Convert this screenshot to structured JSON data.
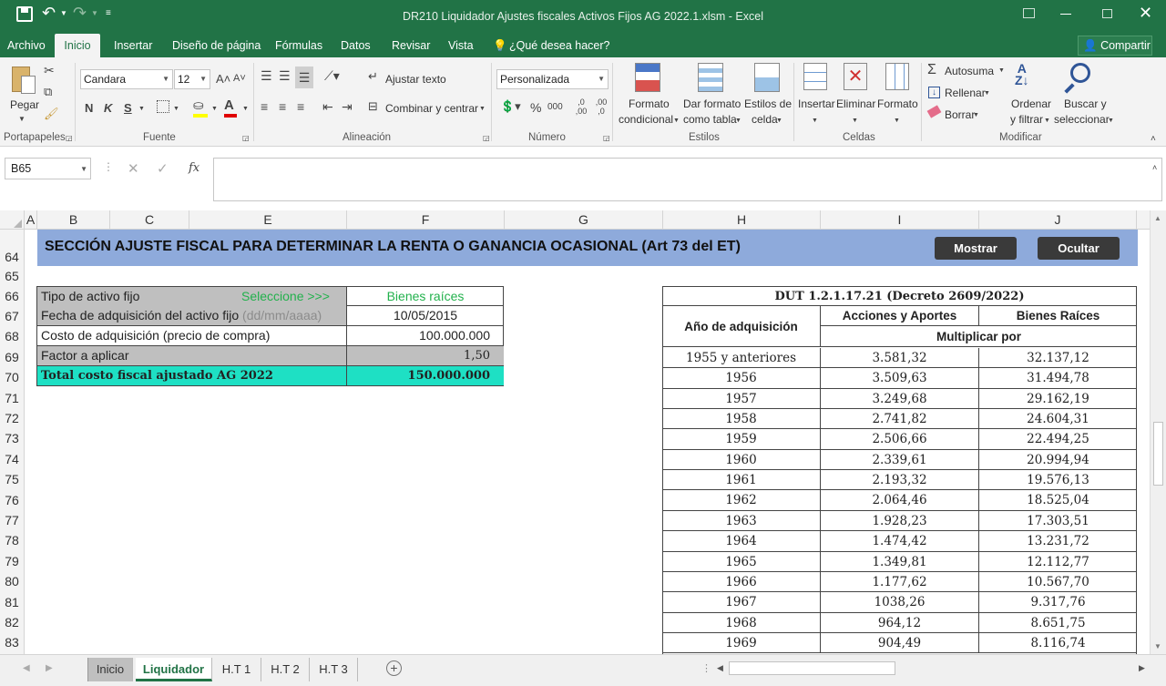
{
  "title": "DR210 Liquidador Ajustes fiscales Activos Fijos AG 2022.1.xlsm - Excel",
  "tabs": [
    "Archivo",
    "Inicio",
    "Insertar",
    "Diseño de página",
    "Fórmulas",
    "Datos",
    "Revisar",
    "Vista",
    "¿Qué desea hacer?"
  ],
  "share_label": "Compartir",
  "ribbon": {
    "paste": "Pegar",
    "font_name": "Candara",
    "font_size": "12",
    "bold": "N",
    "italic": "K",
    "underline": "S",
    "wrap_text": "Ajustar texto",
    "merge_center": "Combinar y centrar",
    "number_format": "Personalizada",
    "percent": "%",
    "thousands": "000",
    "dec_inc": ",0 ,00",
    "dec_dec": ",00 ,0",
    "cond_format": [
      "Formato",
      "condicional"
    ],
    "format_table": [
      "Dar formato",
      "como tabla"
    ],
    "cell_styles": [
      "Estilos de",
      "celda"
    ],
    "insert": "Insertar",
    "delete": "Eliminar",
    "format": "Formato",
    "autosum": "Autosuma",
    "fill": "Rellenar",
    "clear": "Borrar",
    "sort_filter": [
      "Ordenar",
      "y filtrar"
    ],
    "find_select": [
      "Buscar y",
      "seleccionar"
    ],
    "groups": [
      "Portapapeles",
      "Fuente",
      "Alineación",
      "Número",
      "Estilos",
      "Celdas",
      "Modificar"
    ]
  },
  "name_box": "B65",
  "formula": "",
  "columns": [
    "A",
    "B",
    "C",
    "E",
    "F",
    "G",
    "H",
    "I",
    "J"
  ],
  "rows": [
    "64",
    "65",
    "66",
    "67",
    "68",
    "69",
    "70",
    "71",
    "72",
    "73",
    "74",
    "75",
    "76",
    "77",
    "78",
    "79",
    "80",
    "81",
    "82",
    "83"
  ],
  "banner": {
    "title": "SECCIÓN AJUSTE FISCAL PARA DETERMINAR LA RENTA O GANANCIA OCASIONAL (Art 73 del ET)",
    "show": "Mostrar",
    "hide": "Ocultar"
  },
  "left_table": [
    {
      "label": "Tipo de activo fijo",
      "hint": "Seleccione >>>",
      "value": "Bienes raíces"
    },
    {
      "label": "Fecha de adquisición del activo fijo",
      "hint": "(dd/mm/aaaa)",
      "value": "10/05/2015"
    },
    {
      "label": "Costo de adquisición (precio de compra)",
      "value": "100.000.000"
    },
    {
      "label": "Factor a aplicar",
      "value": "1,50"
    },
    {
      "label": "Total costo fiscal ajustado AG 2022",
      "value": "150.000.000"
    }
  ],
  "right_table": {
    "title": "DUT 1.2.1.17.21 (Decreto 2609/2022)",
    "col_year": "Año de adquisición",
    "col_a": "Acciones y Aportes",
    "col_b": "Bienes Raíces",
    "subheader": "Multiplicar por",
    "rows": [
      [
        "1955 y anteriores",
        "3.581,32",
        "32.137,12"
      ],
      [
        "1956",
        "3.509,63",
        "31.494,78"
      ],
      [
        "1957",
        "3.249,68",
        "29.162,19"
      ],
      [
        "1958",
        "2.741,82",
        "24.604,31"
      ],
      [
        "1959",
        "2.506,66",
        "22.494,25"
      ],
      [
        "1960",
        "2.339,61",
        "20.994,94"
      ],
      [
        "1961",
        "2.193,32",
        "19.576,13"
      ],
      [
        "1962",
        "2.064,46",
        "18.525,04"
      ],
      [
        "1963",
        "1.928,23",
        "17.303,51"
      ],
      [
        "1964",
        "1.474,42",
        "13.231,72"
      ],
      [
        "1965",
        "1.349,81",
        "12.112,77"
      ],
      [
        "1966",
        "1.177,62",
        "10.567,70"
      ],
      [
        "1967",
        "1038,26",
        "9.317,76"
      ],
      [
        "1968",
        "964,12",
        "8.651,75"
      ],
      [
        "1969",
        "904,49",
        "8.116,74"
      ]
    ]
  },
  "sheets": [
    "Inicio",
    "Liquidador",
    "H.T 1",
    "H.T 2",
    "H.T 3"
  ],
  "colors": {
    "excel_green": "#217346",
    "banner": "#8eaadb",
    "gray_cell": "#bfbfbf",
    "teal_total": "#1ee0c4",
    "green_text": "#22b14c"
  }
}
